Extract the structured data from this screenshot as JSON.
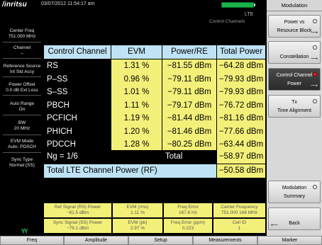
{
  "status": {
    "brand": "/inritsu",
    "datetime": "03/07/2012 11:54:17 am"
  },
  "display": {
    "standard": "LTE",
    "view": "Control Channels"
  },
  "sidebar": [
    {
      "label": "Center Freq",
      "value": "751.000 MHz"
    },
    {
      "label": "Channel",
      "value": "--"
    },
    {
      "label": "Reference Source",
      "value": "Int Std Accy"
    },
    {
      "label": "Power Offset",
      "value": "0.0 dB Ext Loss"
    },
    {
      "label": "Auto Range",
      "value": "On"
    },
    {
      "label": "BW",
      "value": "20 MHz"
    },
    {
      "label": "EVM Mode",
      "value": "Auto: PDSCH"
    },
    {
      "label": "Sync Type",
      "value": "Normal (SS)"
    }
  ],
  "table": {
    "headers": [
      "Control Channel",
      "EVM",
      "Power/RE",
      "Total Power"
    ],
    "rows": [
      [
        "RS",
        "1.31 %",
        "−81.55 dBm",
        "−64.28 dBm"
      ],
      [
        "P–SS",
        "0.96 %",
        "−79.11 dBm",
        "−79.93 dBm"
      ],
      [
        "S–SS",
        "1.01 %",
        "−79.11 dBm",
        "−79.93 dBm"
      ],
      [
        "PBCH",
        "1.11 %",
        "−79.17 dBm",
        "−76.72 dBm"
      ],
      [
        "PCFICH",
        "1.19 %",
        "−81.44 dBm",
        "−81.16 dBm"
      ],
      [
        "PHICH",
        "1.20 %",
        "−81.46 dBm",
        "−77.66 dBm"
      ],
      [
        "PDCCH",
        "1.28 %",
        "−80.25 dBm",
        "−63.44 dBm"
      ]
    ],
    "ng_label": "Ng = 1/6",
    "total_label": "Total",
    "total_value": "−58.97 dBm",
    "rf_label": "Total LTE Channel Power (RF)",
    "rf_value": "−50.58 dBm"
  },
  "metrics": [
    {
      "label": "Ref Signal (RS) Power",
      "value": "−81.5 dBm"
    },
    {
      "label": "EVM (rms)",
      "value": "1.11 %"
    },
    {
      "label": "Freq Error",
      "value": "167.6 Hz"
    },
    {
      "label": "Carrier Frequency",
      "value": "751.000 168 MHz"
    },
    {
      "label": "Sync Signal (SS) Power",
      "value": "−79.1 dBm"
    },
    {
      "label": "EVM (pk)",
      "value": "2.97 %"
    },
    {
      "label": "Freq Error (ppm)",
      "value": "0.223"
    },
    {
      "label": "Cell ID",
      "value": "1"
    }
  ],
  "menu": {
    "title": "Modulation",
    "buttons": [
      {
        "l1": "Power vs",
        "l2": "Resource Block"
      },
      {
        "l1": "",
        "l2": "Constellation"
      },
      {
        "l1": "Control Channel",
        "l2": "Power"
      },
      {
        "l1": "Tx",
        "l2": "Time Alignment"
      },
      {
        "l1": "Modulation",
        "l2": "Summary"
      },
      {
        "l1": "",
        "l2": "Back"
      }
    ]
  },
  "tabs": [
    "Freq",
    "Amplitude",
    "Setup",
    "Measurements",
    "Marker"
  ],
  "colors": {
    "accent_yellow": "#f3f07a",
    "accent_blue": "#bfe3f5",
    "selected_radio": "#e02020"
  }
}
